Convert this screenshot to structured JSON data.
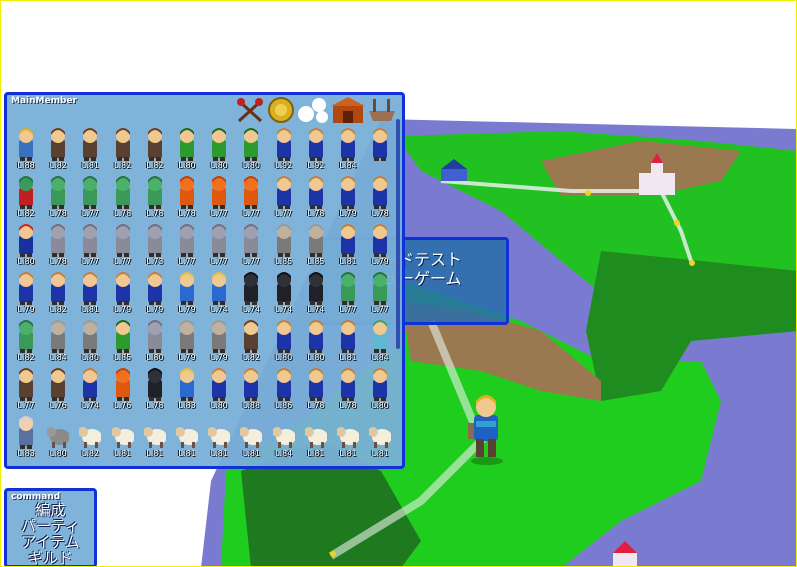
{
  "member_panel": {
    "title": "MainMember"
  },
  "command_panel": {
    "title": "command",
    "items": [
      "編成",
      "パーティ",
      "アイテム",
      "ギルド"
    ]
  },
  "dungeon_menu": {
    "items": [
      "ンドテスト",
      "ューゲーム"
    ]
  },
  "top_icons": [
    "crossed-axes-icon",
    "gold-coin-icon",
    "white-orbs-icon",
    "barn-icon",
    "boat-icon"
  ],
  "members": [
    [
      {
        "lv": "L.88",
        "s": "hero"
      },
      {
        "lv": "L.82",
        "s": "brown"
      },
      {
        "lv": "L.81",
        "s": "brown"
      },
      {
        "lv": "L.82",
        "s": "brown"
      },
      {
        "lv": "L.82",
        "s": "brown"
      },
      {
        "lv": "L.80",
        "s": "green"
      },
      {
        "lv": "L.80",
        "s": "green"
      },
      {
        "lv": "L.80",
        "s": "green"
      },
      {
        "lv": "L.92",
        "s": "mage"
      },
      {
        "lv": "L.92",
        "s": "mage"
      },
      {
        "lv": "L.84",
        "s": "mage"
      },
      {
        "lv": "",
        "s": "mage"
      }
    ],
    [
      {
        "lv": "L.82",
        "s": "redlizard"
      },
      {
        "lv": "L.78",
        "s": "lizard"
      },
      {
        "lv": "L.77",
        "s": "lizard"
      },
      {
        "lv": "L.78",
        "s": "lizard"
      },
      {
        "lv": "L.78",
        "s": "lizard"
      },
      {
        "lv": "L.78",
        "s": "orange"
      },
      {
        "lv": "L.77",
        "s": "orange"
      },
      {
        "lv": "L.77",
        "s": "orange"
      },
      {
        "lv": "L.77",
        "s": "mage"
      },
      {
        "lv": "L.78",
        "s": "mage"
      },
      {
        "lv": "L.79",
        "s": "mage"
      },
      {
        "lv": "L.78",
        "s": "mage"
      }
    ],
    [
      {
        "lv": "L.80",
        "s": "wizard"
      },
      {
        "lv": "L.78",
        "s": "knight"
      },
      {
        "lv": "L.77",
        "s": "knight"
      },
      {
        "lv": "L.77",
        "s": "knight"
      },
      {
        "lv": "L.73",
        "s": "knight"
      },
      {
        "lv": "L.77",
        "s": "knight"
      },
      {
        "lv": "L.77",
        "s": "knight"
      },
      {
        "lv": "L.77",
        "s": "knight"
      },
      {
        "lv": "L.85",
        "s": "grey"
      },
      {
        "lv": "L.85",
        "s": "grey"
      },
      {
        "lv": "L.81",
        "s": "mage"
      },
      {
        "lv": "L.79",
        "s": "mage"
      }
    ],
    [
      {
        "lv": "L.79",
        "s": "mage"
      },
      {
        "lv": "L.82",
        "s": "mage"
      },
      {
        "lv": "L.81",
        "s": "mage"
      },
      {
        "lv": "L.79",
        "s": "mage"
      },
      {
        "lv": "L.79",
        "s": "mage"
      },
      {
        "lv": "L.79",
        "s": "cleric"
      },
      {
        "lv": "L.74",
        "s": "cleric"
      },
      {
        "lv": "L.74",
        "s": "ninja"
      },
      {
        "lv": "L.74",
        "s": "ninja"
      },
      {
        "lv": "L.74",
        "s": "ninja"
      },
      {
        "lv": "L.77",
        "s": "lizard"
      },
      {
        "lv": "L.77",
        "s": "lizard"
      }
    ],
    [
      {
        "lv": "L.82",
        "s": "lizard"
      },
      {
        "lv": "L.84",
        "s": "grey"
      },
      {
        "lv": "L.80",
        "s": "grey"
      },
      {
        "lv": "L.85",
        "s": "green"
      },
      {
        "lv": "L.80",
        "s": "knight"
      },
      {
        "lv": "L.79",
        "s": "grey"
      },
      {
        "lv": "L.79",
        "s": "grey"
      },
      {
        "lv": "L.82",
        "s": "brown"
      },
      {
        "lv": "L.80",
        "s": "mage"
      },
      {
        "lv": "L.80",
        "s": "mage"
      },
      {
        "lv": "L.81",
        "s": "mage"
      },
      {
        "lv": "L.84",
        "s": "light"
      }
    ],
    [
      {
        "lv": "L.77",
        "s": "brown"
      },
      {
        "lv": "L.76",
        "s": "brown"
      },
      {
        "lv": "L.74",
        "s": "mage"
      },
      {
        "lv": "L.76",
        "s": "orange"
      },
      {
        "lv": "L.78",
        "s": "ninja"
      },
      {
        "lv": "L.83",
        "s": "cleric"
      },
      {
        "lv": "L.80",
        "s": "mage"
      },
      {
        "lv": "L.88",
        "s": "mage"
      },
      {
        "lv": "L.86",
        "s": "mage"
      },
      {
        "lv": "L.78",
        "s": "mage"
      },
      {
        "lv": "L.78",
        "s": "mage"
      },
      {
        "lv": "L.80",
        "s": "mage"
      }
    ],
    [
      {
        "lv": "L.83",
        "s": "oldman"
      },
      {
        "lv": "L.80",
        "s": "wolf"
      },
      {
        "lv": "L.82",
        "s": "sheep"
      },
      {
        "lv": "L.81",
        "s": "sheep"
      },
      {
        "lv": "L.81",
        "s": "sheep"
      },
      {
        "lv": "L.81",
        "s": "sheep"
      },
      {
        "lv": "L.81",
        "s": "sheep"
      },
      {
        "lv": "L.81",
        "s": "sheep"
      },
      {
        "lv": "L.84",
        "s": "sheep"
      },
      {
        "lv": "L.81",
        "s": "sheep"
      },
      {
        "lv": "L.81",
        "s": "sheep"
      },
      {
        "lv": "L.81",
        "s": "sheep"
      }
    ]
  ],
  "colors": {
    "panel_border": "#1030d8",
    "panel_fill": "#78afd7",
    "grass": "#1ec81e",
    "water": "#7878c8",
    "dirt": "#9a7850"
  }
}
